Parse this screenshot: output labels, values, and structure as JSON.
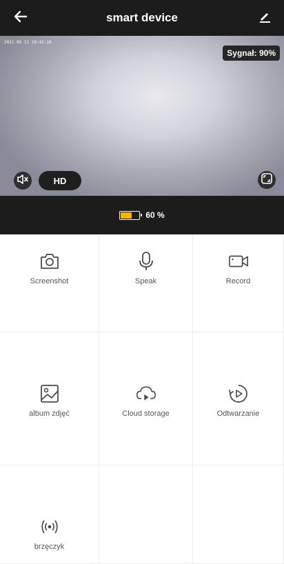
{
  "header": {
    "title": "smart device",
    "back_icon": "arrow-left-icon",
    "edit_icon": "pencil-icon"
  },
  "video": {
    "timestamp": "2021 05 11 18:42:10",
    "signal": "Sygnał: 90%",
    "mute_icon": "speaker-muted-icon",
    "quality": "HD",
    "fullscreen_icon": "fullscreen-icon"
  },
  "status": {
    "battery_icon": "battery-icon",
    "battery_level": 0.6,
    "battery_text": "60 %",
    "battery_color": "#f5b400"
  },
  "features": [
    {
      "label": "Screenshot",
      "icon": "camera-icon"
    },
    {
      "label": "Speak",
      "icon": "microphone-icon"
    },
    {
      "label": "Record",
      "icon": "video-camera-icon"
    },
    {
      "label": "album zdjęć",
      "icon": "image-icon"
    },
    {
      "label": "Cloud storage",
      "icon": "cloud-play-icon"
    },
    {
      "label": "Odtwarzanie",
      "icon": "playback-icon"
    },
    {
      "label": "brzęczyk",
      "icon": "buzzer-icon"
    }
  ]
}
